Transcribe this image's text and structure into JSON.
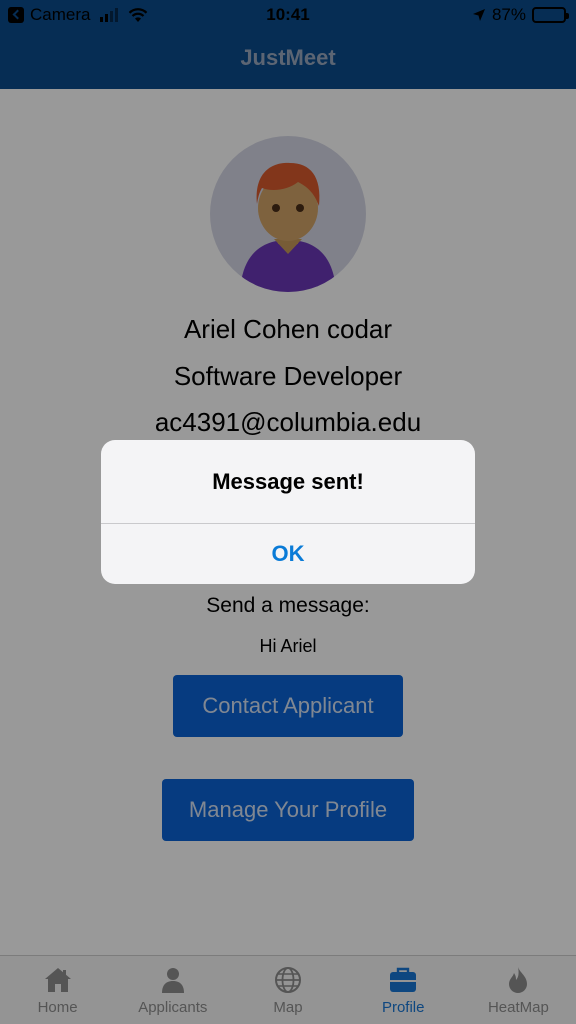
{
  "status_bar": {
    "back_app": "Camera",
    "time": "10:41",
    "battery": "87%",
    "battery_level": 0.87
  },
  "nav": {
    "title": "JustMeet"
  },
  "profile": {
    "avatar_icon": "user-avatar-icon",
    "name": "Ariel Cohen codar",
    "job_title": "Software Developer",
    "email": "ac4391@columbia.edu"
  },
  "message": {
    "label": "Send a message:",
    "text": "Hi Ariel"
  },
  "buttons": {
    "contact": "Contact Applicant",
    "manage": "Manage Your Profile"
  },
  "alert": {
    "title": "Message sent!",
    "ok": "OK"
  },
  "tabs": [
    {
      "label": "Home",
      "icon": "home-icon"
    },
    {
      "label": "Applicants",
      "icon": "person-icon"
    },
    {
      "label": "Map",
      "icon": "globe-icon"
    },
    {
      "label": "Profile",
      "icon": "briefcase-icon",
      "active": true
    },
    {
      "label": "HeatMap",
      "icon": "flame-icon"
    }
  ],
  "colors": {
    "brand": "#0a4c8c",
    "button": "#0a63d6",
    "tab_active": "#1877d6",
    "alert_action": "#0a7bd7"
  }
}
